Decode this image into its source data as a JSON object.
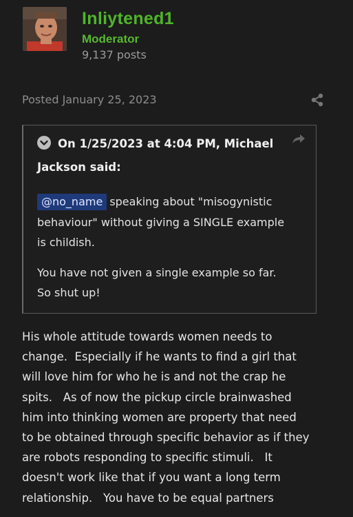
{
  "author": {
    "username": "Inliytened1",
    "rank": "Moderator",
    "posts": "9,137 posts",
    "avatar_icon": "user-avatar-photo"
  },
  "post": {
    "posted": "Posted January 25, 2023",
    "share_icon": "share-icon"
  },
  "quote": {
    "header_line1": "On 1/25/2023 at 4:04 PM, Michael",
    "header_line2": "Jackson said:",
    "mention": "@no_name",
    "p1_line1_rest": "speaking about \"misogynistic",
    "p1_line2": "behaviour\" without giving a SINGLE example",
    "p1_line3": "is childish.",
    "p2_line1": "You have not given a single example so far.",
    "p2_line2": "So shut up!"
  },
  "reply": {
    "lines": [
      "His whole attitude towards women needs to",
      "change.  Especially if he wants to find a girl that",
      "will love him for who he is and not the crap he",
      "spits.   As of now the pickup circle brainwashed",
      "him into thinking women are property that need",
      "to be obtained through specific behavior as if they",
      "are robots responding to specific stimuli.   It",
      "doesn't work like that if you want a long term",
      "relationship.   You have to be equal partners"
    ]
  },
  "colors": {
    "background": "#1c1c1c",
    "username": "#4fb52a",
    "mention_bg": "#1f3a7a"
  }
}
